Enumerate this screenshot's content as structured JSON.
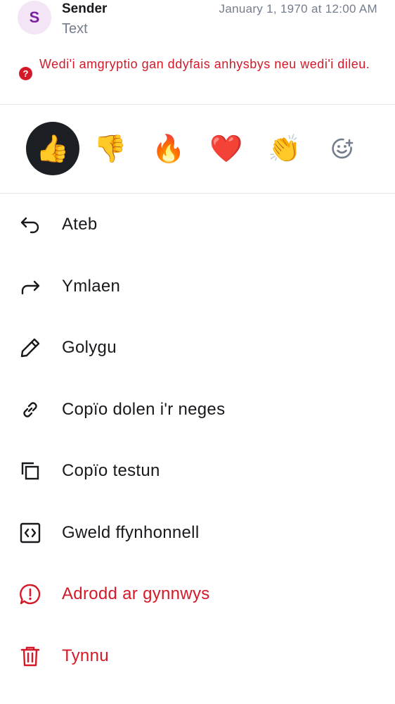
{
  "message": {
    "avatar_letter": "S",
    "sender": "Sender",
    "timestamp": "January 1, 1970 at 12:00 AM",
    "body": "Text",
    "error_icon": "?",
    "error_text": "Wedi'i amgryptio gan ddyfais anhysbys neu wedi'i dileu."
  },
  "reactions": [
    {
      "emoji": "👍",
      "name": "thumbs-up",
      "selected": true
    },
    {
      "emoji": "👎",
      "name": "thumbs-down",
      "selected": false
    },
    {
      "emoji": "🔥",
      "name": "fire",
      "selected": false
    },
    {
      "emoji": "❤️",
      "name": "heart",
      "selected": false
    },
    {
      "emoji": "👏",
      "name": "clapping-hands",
      "selected": false
    }
  ],
  "add_reaction_icon": "add-reaction-icon",
  "menu": [
    {
      "label": "Ateb",
      "icon": "reply-icon"
    },
    {
      "label": "Ymlaen",
      "icon": "forward-icon"
    },
    {
      "label": "Golygu",
      "icon": "edit-icon"
    },
    {
      "label": "Copïo dolen i'r neges",
      "icon": "link-icon"
    },
    {
      "label": "Copïo testun",
      "icon": "copy-icon"
    },
    {
      "label": "Gweld ffynhonnell",
      "icon": "view-source-icon"
    },
    {
      "label": "Adrodd ar gynnwys",
      "icon": "report-icon",
      "danger": true
    },
    {
      "label": "Tynnu",
      "icon": "delete-icon",
      "danger": true
    }
  ],
  "colors": {
    "text": "#17191c",
    "secondary": "#737d8c",
    "danger": "#d51928",
    "avatar_bg": "#f3e5f5",
    "avatar_fg": "#7b1fa2",
    "selected_reaction_bg": "#1c1f24",
    "divider": "#e3e8f0"
  }
}
